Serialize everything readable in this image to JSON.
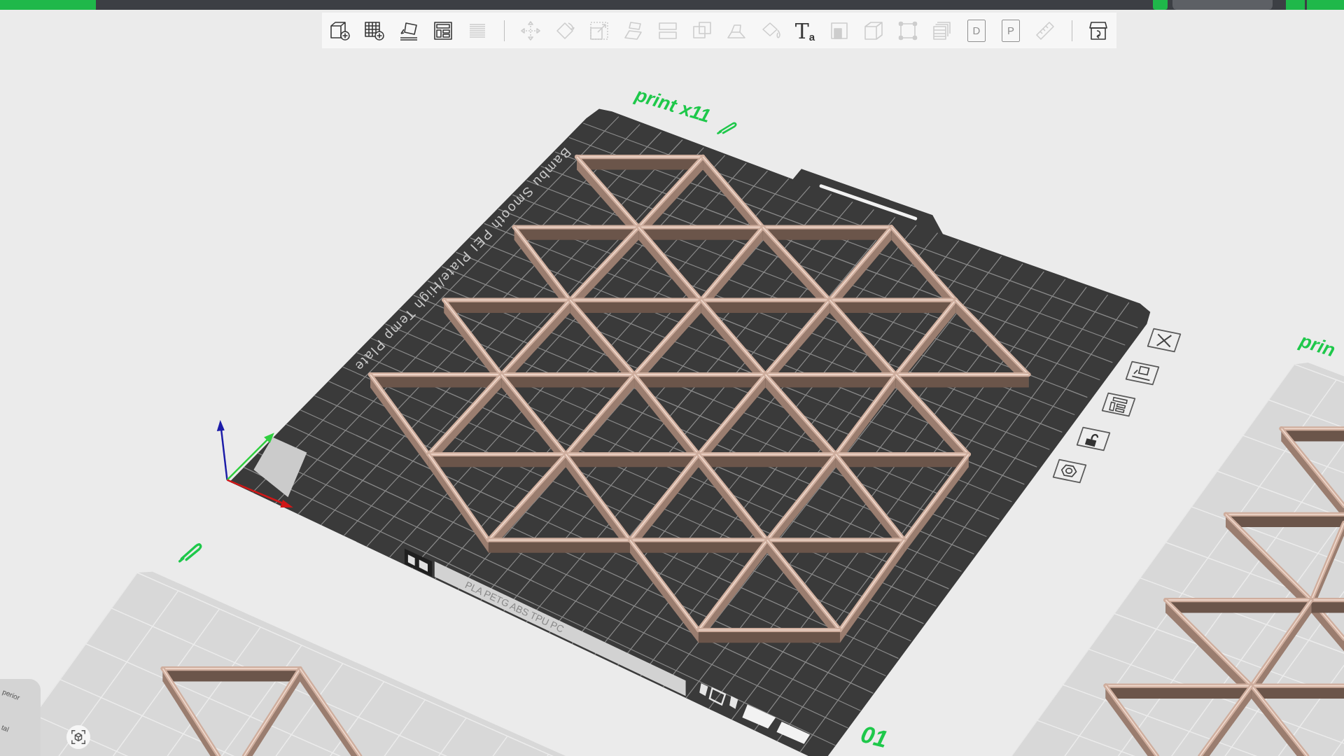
{
  "toolbar": {
    "items": [
      {
        "kind": "add",
        "disabled": false
      },
      {
        "kind": "plate",
        "disabled": false
      },
      {
        "kind": "orient",
        "disabled": false
      },
      {
        "kind": "arrange",
        "disabled": false
      },
      {
        "kind": "lines",
        "disabled": true
      },
      {
        "kind": "separator"
      },
      {
        "kind": "move",
        "disabled": true
      },
      {
        "kind": "rotate",
        "disabled": true
      },
      {
        "kind": "scale",
        "disabled": true
      },
      {
        "kind": "lay",
        "disabled": true
      },
      {
        "kind": "cut",
        "disabled": true
      },
      {
        "kind": "boolean",
        "disabled": true
      },
      {
        "kind": "wedge",
        "disabled": true
      },
      {
        "kind": "paint",
        "disabled": true
      },
      {
        "kind": "glyph",
        "glyph": "Ta",
        "disabled": false
      },
      {
        "kind": "fill",
        "disabled": true
      },
      {
        "kind": "cube",
        "disabled": true
      },
      {
        "kind": "bounds",
        "disabled": true
      },
      {
        "kind": "stack",
        "disabled": true
      },
      {
        "kind": "page",
        "glyph": "D",
        "disabled": true
      },
      {
        "kind": "page",
        "glyph": "P",
        "disabled": true
      },
      {
        "kind": "ruler",
        "disabled": true
      },
      {
        "kind": "separator"
      },
      {
        "kind": "assembly",
        "disabled": false
      }
    ]
  },
  "main_plate": {
    "name": "print x11",
    "number": "01",
    "surface_text": "Bambu Smooth PEI Plate/High Temp Plate",
    "label_strip": "PLA PETG ABS TPU PC",
    "actions": [
      {
        "kind": "close"
      },
      {
        "kind": "orient"
      },
      {
        "kind": "arrange"
      },
      {
        "kind": "lock",
        "locked": false
      },
      {
        "kind": "settings"
      }
    ]
  },
  "right_plate": {
    "name": "prin"
  },
  "view_cube": {
    "faces": [
      "perior",
      "tal"
    ]
  }
}
